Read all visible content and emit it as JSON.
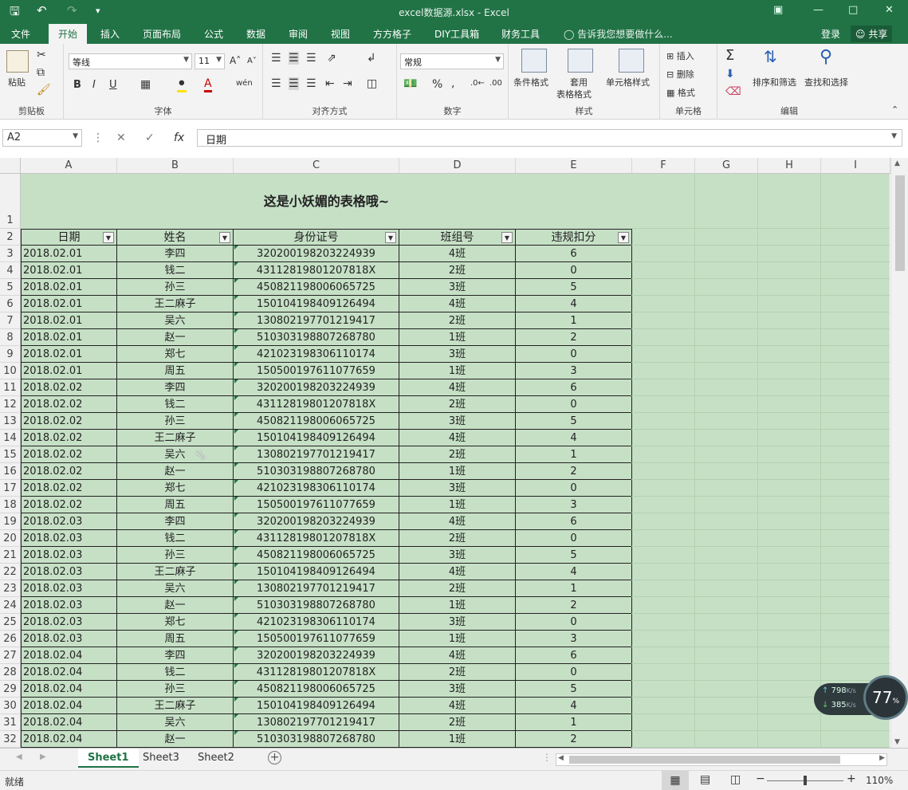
{
  "window": {
    "title": "excel数据源.xlsx - Excel"
  },
  "ribbon_tabs": [
    "文件",
    "开始",
    "插入",
    "页面布局",
    "公式",
    "数据",
    "审阅",
    "视图",
    "方方格子",
    "DIY工具箱",
    "财务工具"
  ],
  "tell_me": "告诉我您想要做什么...",
  "account": {
    "login": "登录",
    "share": "共享"
  },
  "ribbon": {
    "clipboard": {
      "paste": "粘贴",
      "label": "剪贴板"
    },
    "font": {
      "name": "等线",
      "size": "11",
      "label": "字体",
      "bold": "B",
      "italic": "I",
      "underline": "U"
    },
    "align": {
      "label": "对齐方式"
    },
    "number": {
      "format": "常规",
      "label": "数字"
    },
    "styles": {
      "cond": "条件格式",
      "table1": "套用",
      "table2": "表格格式",
      "cellstyle": "单元格样式",
      "label": "样式"
    },
    "cells": {
      "insert": "插入",
      "delete": "删除",
      "format": "格式",
      "label": "单元格"
    },
    "edit": {
      "sort": "排序和筛选",
      "find": "查找和选择",
      "label": "编辑"
    }
  },
  "formula_bar": {
    "name_box": "A2",
    "fx": "fx",
    "value": "日期"
  },
  "columns": [
    "A",
    "B",
    "C",
    "D",
    "E",
    "F",
    "G",
    "H",
    "I"
  ],
  "sheet": {
    "title": "这是小妖媚的表格哦~",
    "headers": [
      "日期",
      "姓名",
      "身份证号",
      "班组号",
      "违规扣分"
    ],
    "rows": [
      [
        "2018.02.01",
        "李四",
        "320200198203224939",
        "4班",
        "6"
      ],
      [
        "2018.02.01",
        "钱二",
        "43112819801207818X",
        "2班",
        "0"
      ],
      [
        "2018.02.01",
        "孙三",
        "450821198006065725",
        "3班",
        "5"
      ],
      [
        "2018.02.01",
        "王二麻子",
        "150104198409126494",
        "4班",
        "4"
      ],
      [
        "2018.02.01",
        "吴六",
        "130802197701219417",
        "2班",
        "1"
      ],
      [
        "2018.02.01",
        "赵一",
        "510303198807268780",
        "1班",
        "2"
      ],
      [
        "2018.02.01",
        "郑七",
        "421023198306110174",
        "3班",
        "0"
      ],
      [
        "2018.02.01",
        "周五",
        "150500197611077659",
        "1班",
        "3"
      ],
      [
        "2018.02.02",
        "李四",
        "320200198203224939",
        "4班",
        "6"
      ],
      [
        "2018.02.02",
        "钱二",
        "43112819801207818X",
        "2班",
        "0"
      ],
      [
        "2018.02.02",
        "孙三",
        "450821198006065725",
        "3班",
        "5"
      ],
      [
        "2018.02.02",
        "王二麻子",
        "150104198409126494",
        "4班",
        "4"
      ],
      [
        "2018.02.02",
        "吴六",
        "130802197701219417",
        "2班",
        "1"
      ],
      [
        "2018.02.02",
        "赵一",
        "510303198807268780",
        "1班",
        "2"
      ],
      [
        "2018.02.02",
        "郑七",
        "421023198306110174",
        "3班",
        "0"
      ],
      [
        "2018.02.02",
        "周五",
        "150500197611077659",
        "1班",
        "3"
      ],
      [
        "2018.02.03",
        "李四",
        "320200198203224939",
        "4班",
        "6"
      ],
      [
        "2018.02.03",
        "钱二",
        "43112819801207818X",
        "2班",
        "0"
      ],
      [
        "2018.02.03",
        "孙三",
        "450821198006065725",
        "3班",
        "5"
      ],
      [
        "2018.02.03",
        "王二麻子",
        "150104198409126494",
        "4班",
        "4"
      ],
      [
        "2018.02.03",
        "吴六",
        "130802197701219417",
        "2班",
        "1"
      ],
      [
        "2018.02.03",
        "赵一",
        "510303198807268780",
        "1班",
        "2"
      ],
      [
        "2018.02.03",
        "郑七",
        "421023198306110174",
        "3班",
        "0"
      ],
      [
        "2018.02.03",
        "周五",
        "150500197611077659",
        "1班",
        "3"
      ],
      [
        "2018.02.04",
        "李四",
        "320200198203224939",
        "4班",
        "6"
      ],
      [
        "2018.02.04",
        "钱二",
        "43112819801207818X",
        "2班",
        "0"
      ],
      [
        "2018.02.04",
        "孙三",
        "450821198006065725",
        "3班",
        "5"
      ],
      [
        "2018.02.04",
        "王二麻子",
        "150104198409126494",
        "4班",
        "4"
      ],
      [
        "2018.02.04",
        "吴六",
        "130802197701219417",
        "2班",
        "1"
      ],
      [
        "2018.02.04",
        "赵一",
        "510303198807268780",
        "1班",
        "2"
      ]
    ]
  },
  "sheet_tabs": [
    "Sheet1",
    "Sheet3",
    "Sheet2"
  ],
  "status": {
    "ready": "就绪",
    "zoom": "110%"
  },
  "net_widget": {
    "up": "798",
    "down": "385",
    "unit": "K/s",
    "percent": "77",
    "pct_sign": "%"
  },
  "colors": {
    "excel_green": "#217346",
    "sheet_fill": "#c6e0c6"
  }
}
